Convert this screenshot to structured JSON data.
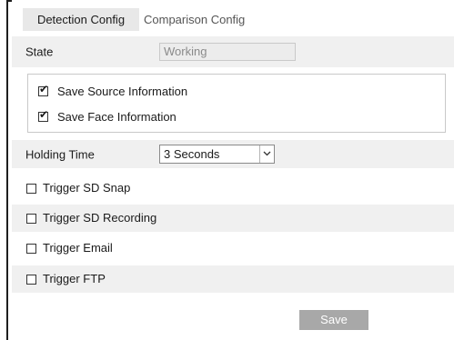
{
  "tabs": [
    {
      "label": "Detection Config",
      "active": true
    },
    {
      "label": "Comparison Config",
      "active": false
    }
  ],
  "state": {
    "label": "State",
    "value": "Working"
  },
  "info": {
    "save_source": {
      "label": "Save Source Information",
      "checked": true
    },
    "save_face": {
      "label": "Save Face Information",
      "checked": true
    }
  },
  "holding_time": {
    "label": "Holding Time",
    "value": "3 Seconds"
  },
  "triggers": [
    {
      "label": "Trigger SD Snap",
      "checked": false
    },
    {
      "label": "Trigger SD Recording",
      "checked": false
    },
    {
      "label": "Trigger Email",
      "checked": false
    },
    {
      "label": "Trigger FTP",
      "checked": false
    }
  ],
  "save_label": "Save",
  "colors": {
    "shaded_row": "#f0f0f0",
    "active_tab": "#e8e8e8",
    "save_button": "#a8a8a8",
    "disabled_text": "#8a8a8a"
  }
}
